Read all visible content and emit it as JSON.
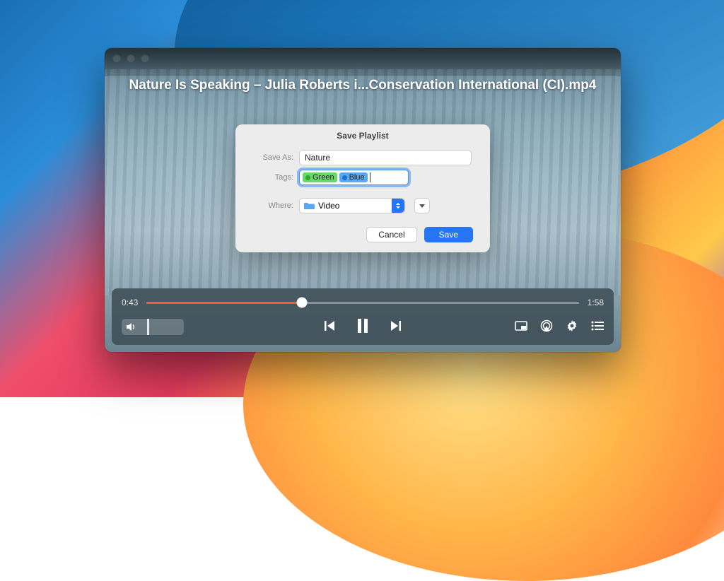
{
  "video": {
    "title": "Nature Is Speaking – Julia Roberts i...Conservation International (CI).mp4",
    "elapsed": "0:43",
    "remaining": "1:58",
    "progress_pct": 36
  },
  "dialog": {
    "title": "Save Playlist",
    "labels": {
      "save_as": "Save As:",
      "tags": "Tags:",
      "where": "Where:"
    },
    "save_as_value": "Nature",
    "tags": [
      {
        "name": "Green",
        "color": "green"
      },
      {
        "name": "Blue",
        "color": "blue"
      }
    ],
    "where_value": "Video",
    "buttons": {
      "cancel": "Cancel",
      "save": "Save"
    }
  },
  "colors": {
    "accent": "#2575f5",
    "progress": "#ff5a3c"
  }
}
